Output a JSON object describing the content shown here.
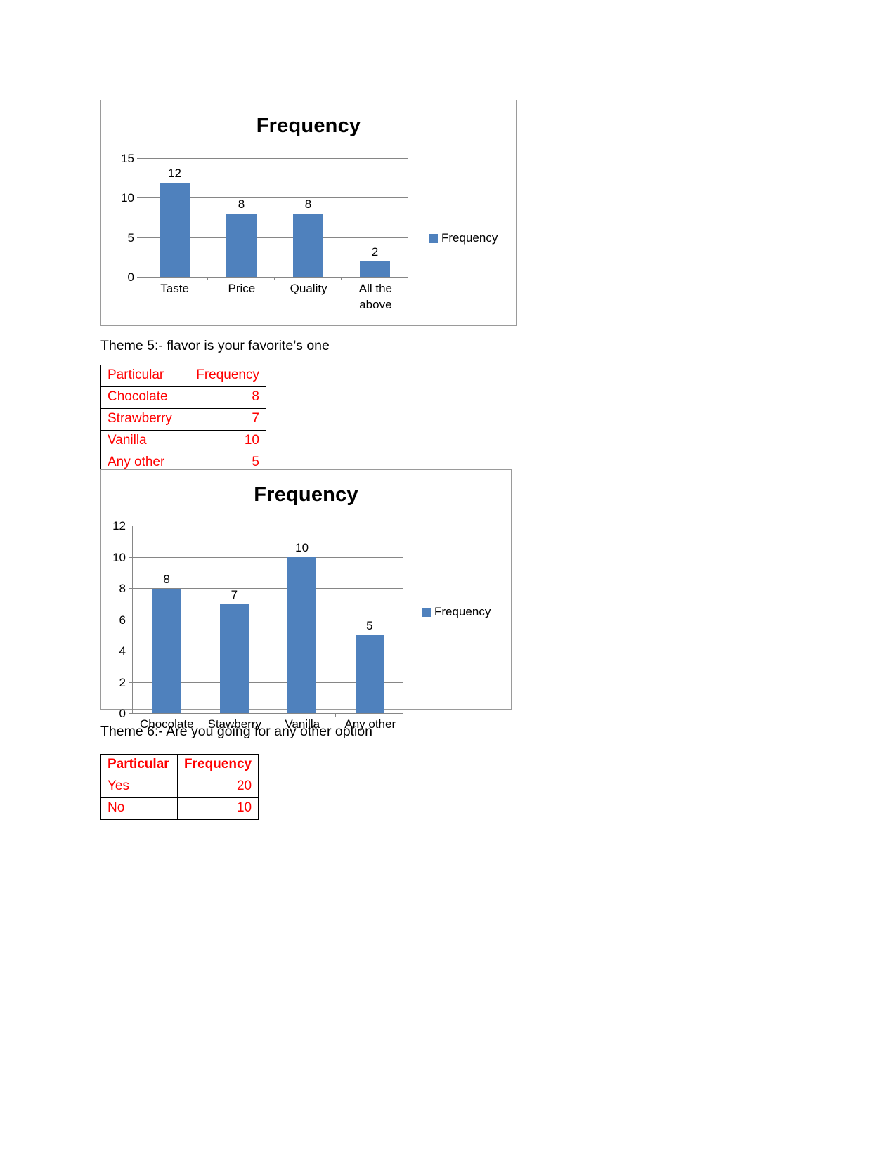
{
  "page": {
    "background": "#ffffff",
    "text_color": "#000000",
    "table_text_color": "#ff0000",
    "bar_color": "#4f81bd",
    "gridline_color": "#868686"
  },
  "theme5": {
    "heading": "Theme 5:- flavor is your favorite’s one"
  },
  "theme6": {
    "heading": "Theme 6:- Are you going for any other option"
  },
  "table_flavors": {
    "name": "flavor-frequency-table",
    "headers": [
      "Particular",
      "Frequency"
    ],
    "rows": [
      {
        "label": "Chocolate",
        "value": "8"
      },
      {
        "label": "Strawberry",
        "value": "7"
      },
      {
        "label": "Vanilla",
        "value": "10"
      },
      {
        "label": "Any other",
        "value": "5"
      }
    ]
  },
  "table_yesno": {
    "name": "other-option-frequency-table",
    "headers": [
      "Particular",
      "Frequency"
    ],
    "rows": [
      {
        "label": "Yes",
        "value": "20"
      },
      {
        "label": "No",
        "value": "10"
      }
    ]
  },
  "chart_data": [
    {
      "id": "chart-1",
      "type": "bar",
      "title": "Frequency",
      "xlabel": "",
      "ylabel": "",
      "categories": [
        "Taste",
        "Price",
        "Quality",
        "All the above"
      ],
      "values": [
        12,
        8,
        8,
        2
      ],
      "series": [
        {
          "name": "Frequency",
          "values": [
            12,
            8,
            8,
            2
          ]
        }
      ],
      "data_labels": [
        "12",
        "8",
        "8",
        "2"
      ],
      "ylim": [
        0,
        15
      ],
      "yticks": [
        0,
        5,
        10,
        15
      ],
      "ytick_labels": [
        "0",
        "5",
        "10",
        "15"
      ],
      "grid": true,
      "legend": {
        "position": "right",
        "entries": [
          "Frequency"
        ]
      },
      "bar_color": "#4f81bd"
    },
    {
      "id": "chart-2",
      "type": "bar",
      "title": "Frequency",
      "xlabel": "",
      "ylabel": "",
      "categories": [
        "Chocolate",
        "Stawberry",
        "Vanilla",
        "Any other"
      ],
      "values": [
        8,
        7,
        10,
        5
      ],
      "series": [
        {
          "name": "Frequency",
          "values": [
            8,
            7,
            10,
            5
          ]
        }
      ],
      "data_labels": [
        "8",
        "7",
        "10",
        "5"
      ],
      "ylim": [
        0,
        12
      ],
      "yticks": [
        0,
        2,
        4,
        6,
        8,
        10,
        12
      ],
      "ytick_labels": [
        "0",
        "2",
        "4",
        "6",
        "8",
        "10",
        "12"
      ],
      "grid": true,
      "legend": {
        "position": "right",
        "entries": [
          "Frequency"
        ]
      },
      "bar_color": "#4f81bd"
    }
  ]
}
